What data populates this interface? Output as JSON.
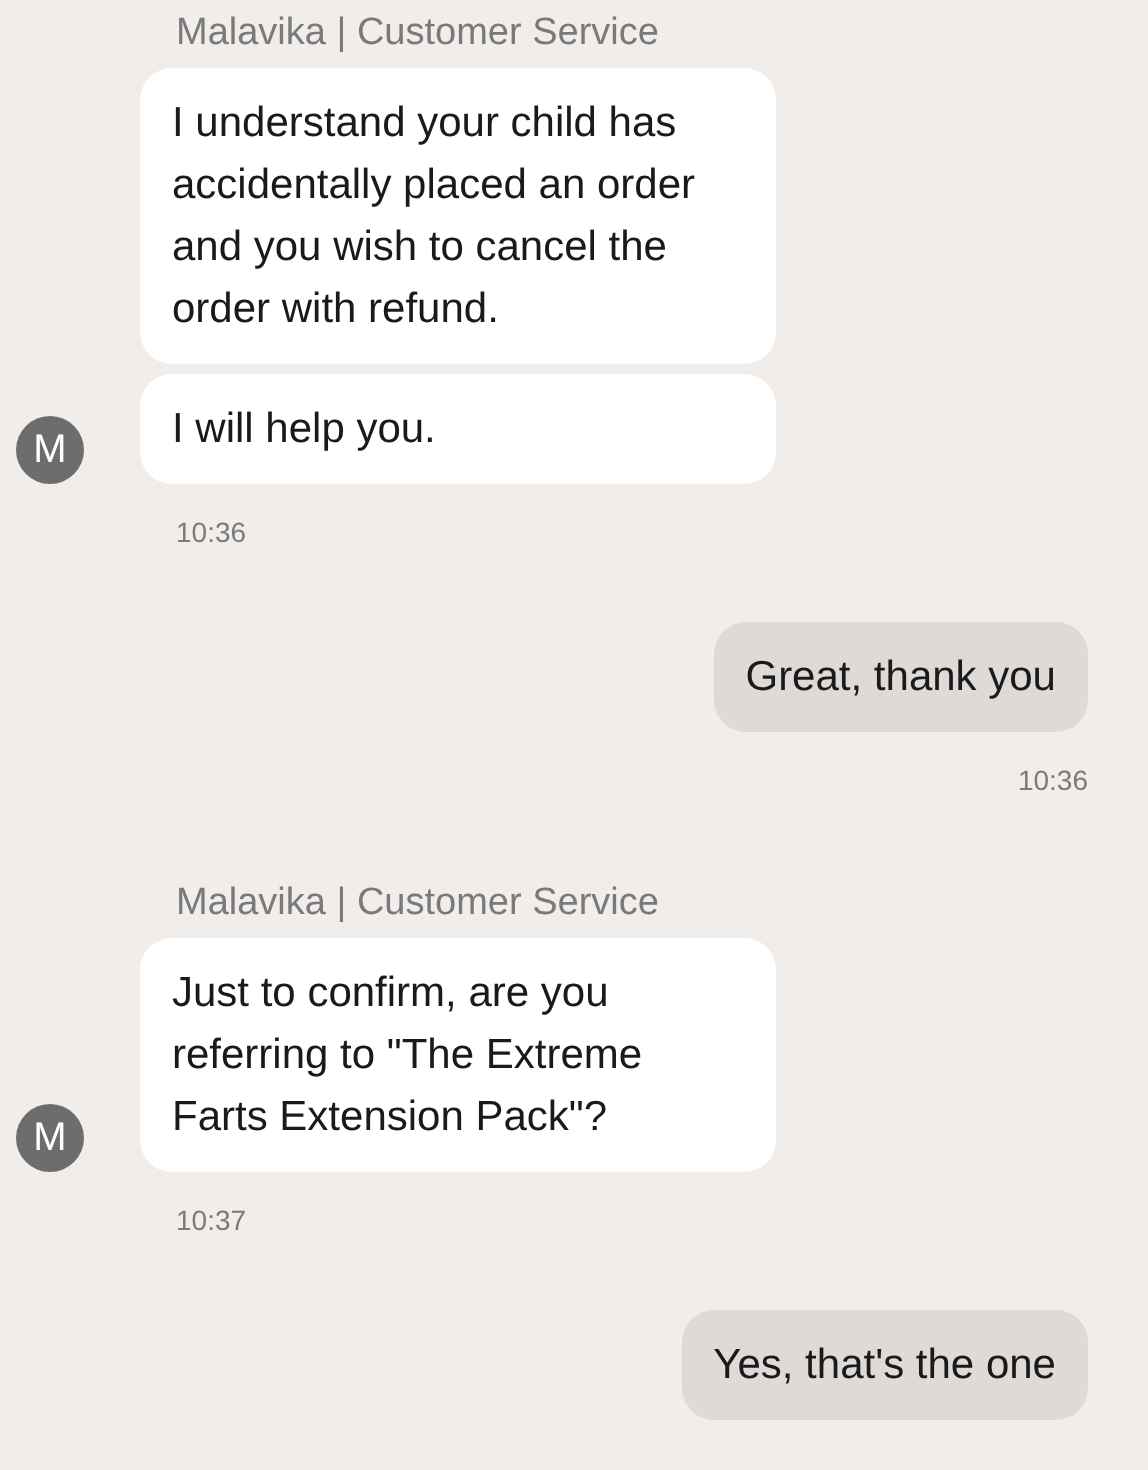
{
  "messages": [
    {
      "kind": "agent",
      "sender": "Malavika | Customer Service",
      "avatar": "M",
      "bubbles": [
        "I understand your child has accidentally placed an order and you wish to cancel the order with refund.",
        "I will help you."
      ],
      "time": "10:36"
    },
    {
      "kind": "user",
      "bubbles": [
        "Great, thank you"
      ],
      "time": "10:36"
    },
    {
      "kind": "agent",
      "sender": "Malavika | Customer Service",
      "avatar": "M",
      "bubbles": [
        "Just to confirm, are you referring to \"The Extreme Farts Extension Pack\"?"
      ],
      "time": "10:37"
    },
    {
      "kind": "user",
      "bubbles": [
        "Yes, that's the one"
      ]
    }
  ]
}
